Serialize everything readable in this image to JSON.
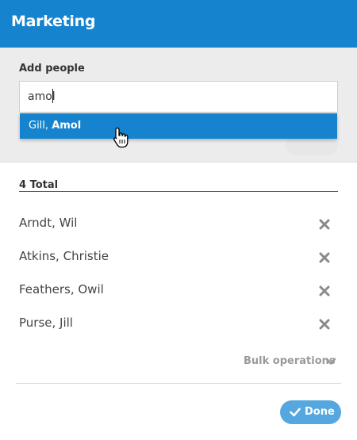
{
  "header": {
    "title": "Marketing"
  },
  "add_people": {
    "label": "Add people",
    "search_value": "amol",
    "suggestion": {
      "last": "Gill,",
      "first": "Amol"
    }
  },
  "total": {
    "label": "4 Total"
  },
  "people": [
    {
      "name": "Arndt, Wil"
    },
    {
      "name": "Atkins, Christie"
    },
    {
      "name": "Feathers, Owil"
    },
    {
      "name": "Purse, Jill"
    }
  ],
  "icons": {
    "remove": "close-icon",
    "bulk": "chevron-down-icon",
    "done": "check-icon",
    "cursor": "hand-pointer-icon"
  },
  "footer": {
    "bulk_label": "Bulk operations",
    "done_label": "Done"
  },
  "colors": {
    "header_bg": "#1583cd",
    "suggestion_bg": "#1583cd",
    "done_bg": "#54a7df",
    "muted_text": "#9a9a9a"
  }
}
